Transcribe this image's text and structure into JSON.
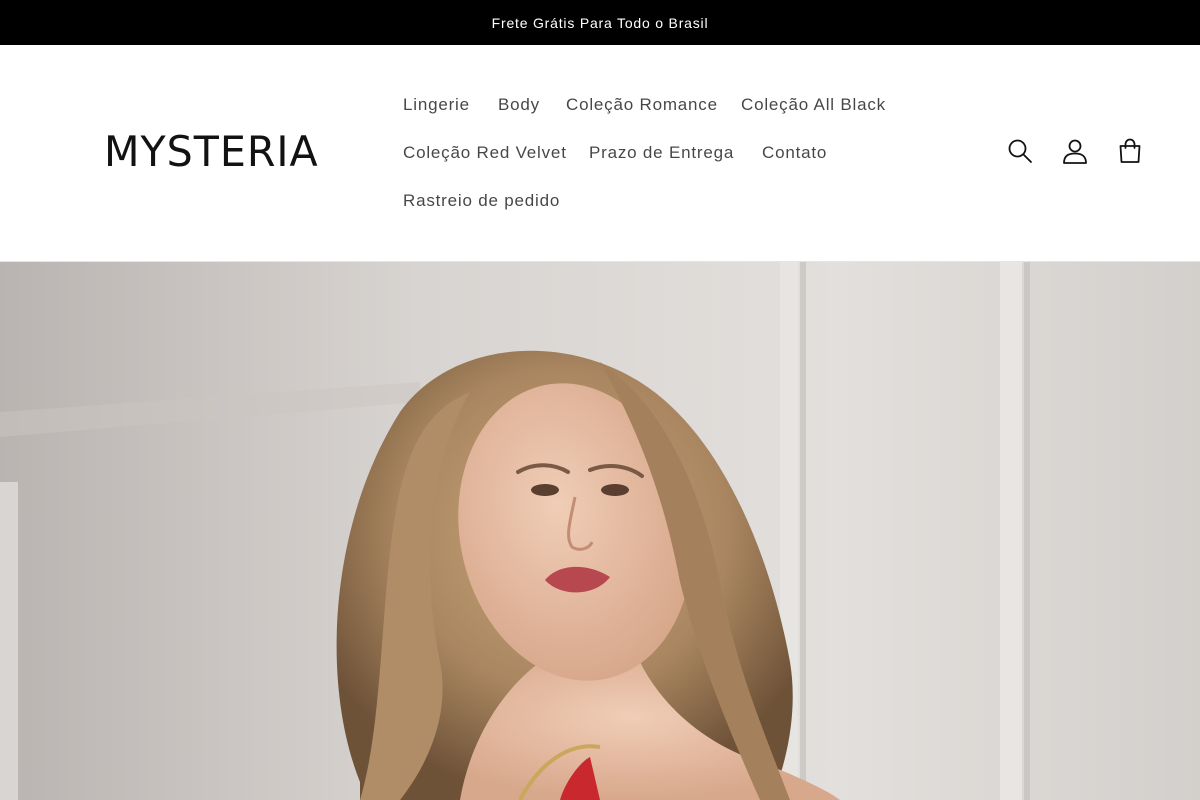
{
  "announcement": {
    "text": "Frete Grátis Para Todo o Brasil"
  },
  "header": {
    "logo": "MYSTERIA",
    "nav": [
      {
        "label": "Lingerie"
      },
      {
        "label": "Body"
      },
      {
        "label": "Coleção Romance"
      },
      {
        "label": "Coleção All Black"
      },
      {
        "label": "Coleção Red Velvet"
      },
      {
        "label": "Prazo de Entrega"
      },
      {
        "label": "Contato"
      },
      {
        "label": "Rastreio de pedido"
      }
    ],
    "icons": [
      "search-icon",
      "account-icon",
      "cart-icon"
    ]
  },
  "colors": {
    "announcement_bg": "#000000",
    "text": "#121212",
    "hero_bg": "#d9d6d4"
  }
}
